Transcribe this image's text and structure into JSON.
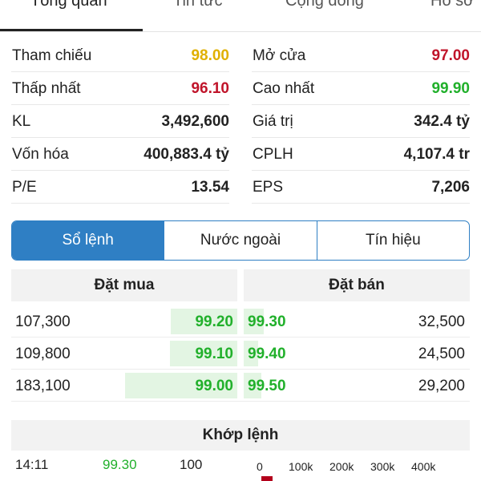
{
  "tabs": [
    {
      "label": "Tổng quan",
      "active": true
    },
    {
      "label": "Tin tức",
      "active": false
    },
    {
      "label": "Cộng đồng",
      "active": false
    },
    {
      "label": "Hồ sơ",
      "active": false
    }
  ],
  "stats": {
    "left": [
      {
        "label": "Tham chiếu",
        "value": "98.00",
        "color": "#e0b000"
      },
      {
        "label": "Thấp nhất",
        "value": "96.10",
        "color": "#c0142a"
      },
      {
        "label": "KL",
        "value": "3,492,600"
      },
      {
        "label": "Vốn hóa",
        "value": "400,883.4 tỷ"
      },
      {
        "label": "P/E",
        "value": "13.54"
      }
    ],
    "right": [
      {
        "label": "Mở cửa",
        "value": "97.00",
        "color": "#c0142a"
      },
      {
        "label": "Cao nhất",
        "value": "99.90",
        "color": "#21b02b"
      },
      {
        "label": "Giá trị",
        "value": "342.4 tỷ"
      },
      {
        "label": "CPLH",
        "value": "4,107.4 tr"
      },
      {
        "label": "EPS",
        "value": "7,206"
      }
    ]
  },
  "segments": [
    {
      "label": "Sổ lệnh",
      "active": true
    },
    {
      "label": "Nước ngoài",
      "active": false
    },
    {
      "label": "Tín hiệu",
      "active": false
    }
  ],
  "orderbook": {
    "buy_header": "Đặt mua",
    "sell_header": "Đặt bán",
    "rows": [
      {
        "buy_qty": "107,300",
        "buy_price": "99.20",
        "sell_price": "99.30",
        "sell_qty": "32,500",
        "buy_level": 0.59,
        "sell_level": 0.18
      },
      {
        "buy_qty": "109,800",
        "buy_price": "99.10",
        "sell_price": "99.40",
        "sell_qty": "24,500",
        "buy_level": 0.6,
        "sell_level": 0.13
      },
      {
        "buy_qty": "183,100",
        "buy_price": "99.00",
        "sell_price": "99.50",
        "sell_qty": "29,200",
        "buy_level": 1.0,
        "sell_level": 0.16
      }
    ],
    "color_price": "#21b02b",
    "color_bar": "#e3f5e3"
  },
  "matching": {
    "header": "Khớp lệnh",
    "rows": [
      {
        "time": "14:11",
        "price": "99.30",
        "volume": "100"
      }
    ],
    "volume_axis": [
      "0",
      "100k",
      "200k",
      "300k",
      "400k"
    ]
  },
  "colors": {
    "accent": "#2f7fc4"
  }
}
